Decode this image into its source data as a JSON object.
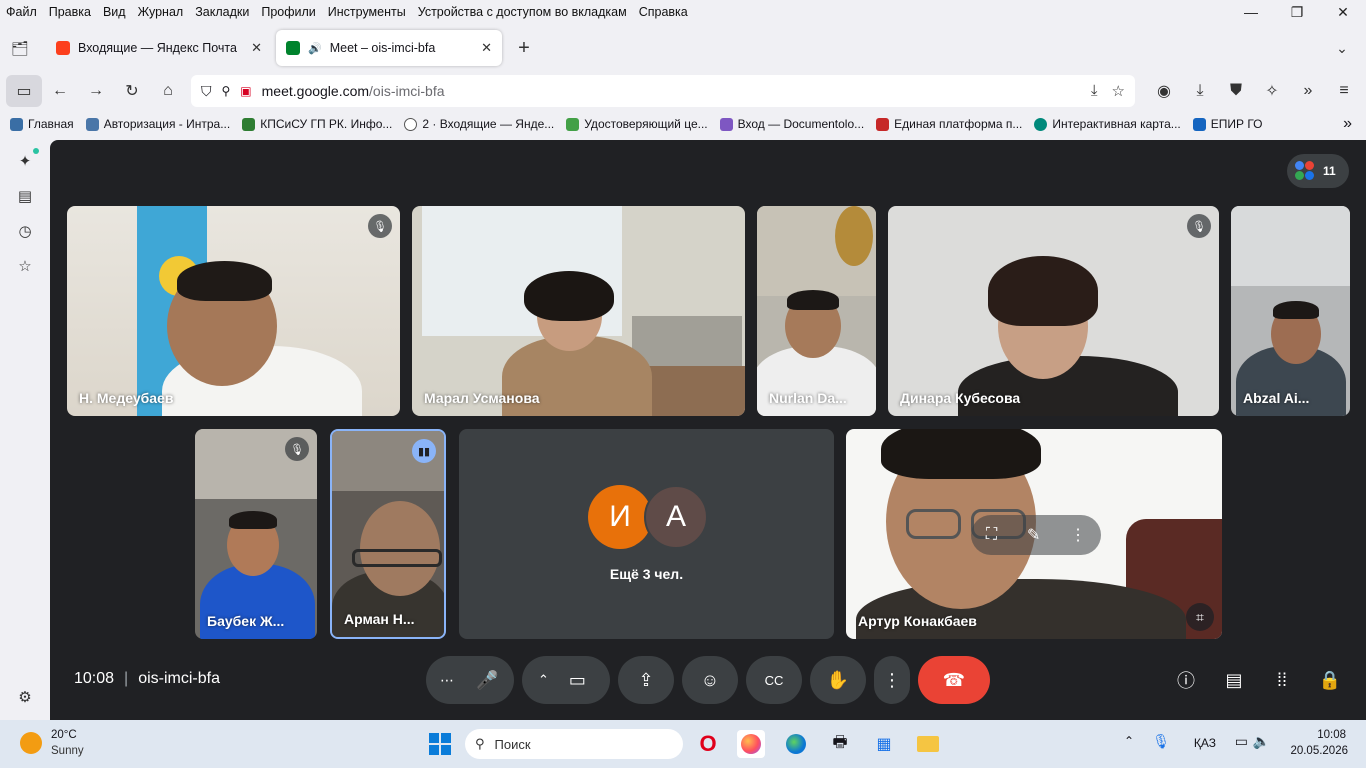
{
  "menu": [
    "Файл",
    "Правка",
    "Вид",
    "Журнал",
    "Закладки",
    "Профили",
    "Инструменты",
    "Устройства с доступом во вкладкам",
    "Справка"
  ],
  "tabs": [
    {
      "title": "Входящие — Яндекс Почта",
      "color": "#fc3f1d"
    },
    {
      "title": "Meet – ois-imci-bfa",
      "color": "#00832d"
    }
  ],
  "url": {
    "domain": "meet.google.com",
    "path": "/ois-imci-bfa"
  },
  "bookmarks": [
    {
      "label": "Главная",
      "color": "#3a6ea5"
    },
    {
      "label": "Авторизация - Интра...",
      "color": "#4a76a8"
    },
    {
      "label": "КПСиСУ ГП РК. Инфо...",
      "color": "#2e7d32"
    },
    {
      "label": "2 · Входящие — Янде...",
      "color": "#555555"
    },
    {
      "label": "Удостоверяющий це...",
      "color": "#43a047"
    },
    {
      "label": "Вход — Documentolo...",
      "color": "#7e57c2"
    },
    {
      "label": "Единая платформа п...",
      "color": "#c62828"
    },
    {
      "label": "Интерактивная карта...",
      "color": "#00897b"
    },
    {
      "label": "ЕПИР ГО",
      "color": "#1565c0"
    }
  ],
  "meet": {
    "participant_count": "11",
    "participants": [
      {
        "name": "Н. Медеубаев",
        "muted": true
      },
      {
        "name": "Марал Усманова",
        "muted": false
      },
      {
        "name": "Nurlan Da...",
        "muted": false
      },
      {
        "name": "Динара Кубесова",
        "muted": true
      },
      {
        "name": "Abzal Ai...",
        "muted": false
      },
      {
        "name": "Баубек Ж...",
        "muted": true
      },
      {
        "name": "Арман Н...",
        "speaking": true
      },
      {
        "name": "Артур Конакбаев",
        "muted": false
      }
    ],
    "others": {
      "avatar1": "И",
      "avatar2": "А",
      "label": "Ещё 3 чел.",
      "avatar1_color": "#e8710a",
      "avatar2_color": "#5f4b48"
    },
    "time": "10:08",
    "code": "ois-imci-bfa",
    "end_color": "#ea4335"
  },
  "weather": {
    "temp": "20°C",
    "cond": "Sunny"
  },
  "search_placeholder": "Поиск",
  "lang": "ҚАЗ",
  "clock": {
    "time": "10:08",
    "date": "20.05.2026"
  }
}
